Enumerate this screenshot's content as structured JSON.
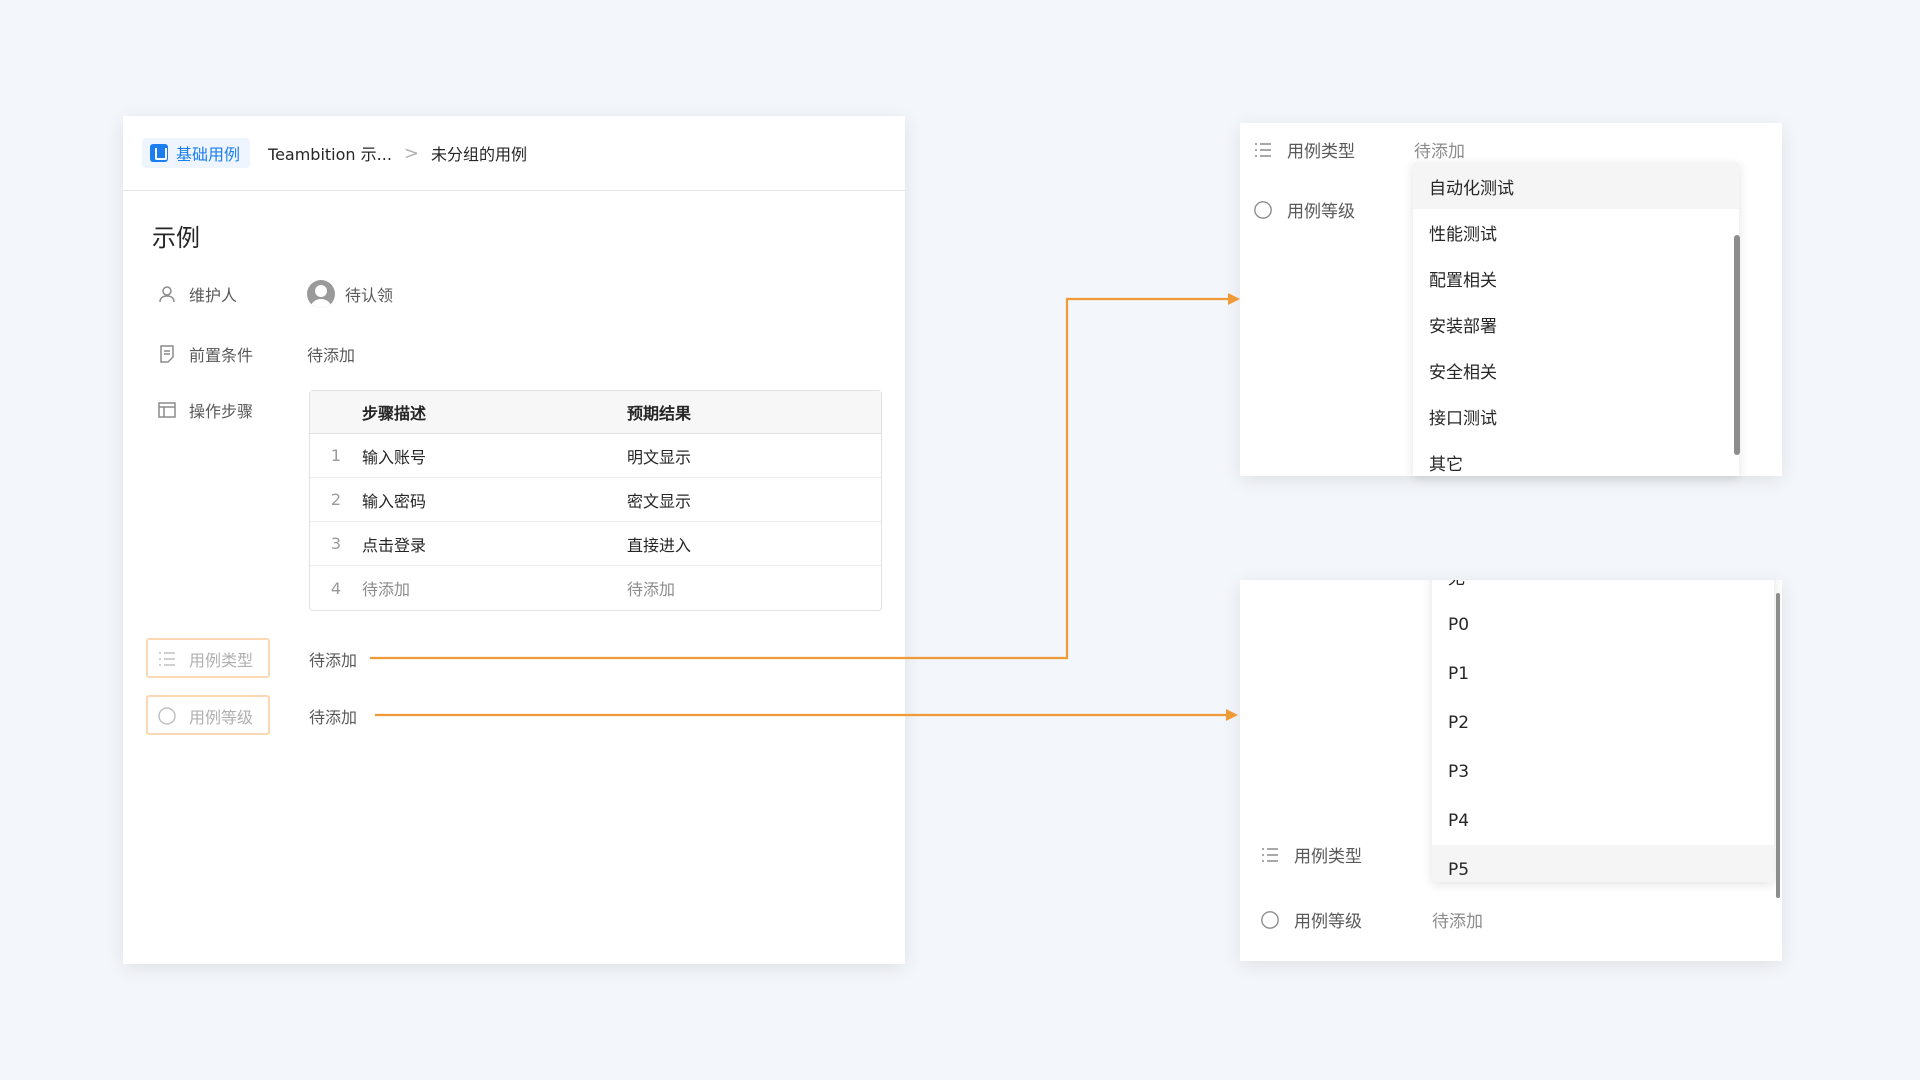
{
  "breadcrumb": {
    "tag_label": "基础用例",
    "project": "Teambition 示...",
    "separator": ">",
    "group": "未分组的用例"
  },
  "case": {
    "title": "示例",
    "maintainer_label": "维护人",
    "maintainer_value": "待认领",
    "precondition_label": "前置条件",
    "precondition_value": "待添加",
    "steps_label": "操作步骤",
    "steps_header": {
      "desc": "步骤描述",
      "expect": "预期结果"
    },
    "steps": [
      {
        "no": "1",
        "desc": "输入账号",
        "expect": "明文显示"
      },
      {
        "no": "2",
        "desc": "输入密码",
        "expect": "密文显示"
      },
      {
        "no": "3",
        "desc": "点击登录",
        "expect": "直接进入"
      },
      {
        "no": "4",
        "desc": "待添加",
        "expect": "待添加"
      }
    ],
    "type_label": "用例类型",
    "type_value": "待添加",
    "level_label": "用例等级",
    "level_value": "待添加"
  },
  "type_panel": {
    "type_label": "用例类型",
    "type_value": "待添加",
    "level_label": "用例等级",
    "options": [
      "自动化测试",
      "性能测试",
      "配置相关",
      "安装部署",
      "安全相关",
      "接口测试",
      "其它"
    ]
  },
  "level_panel": {
    "type_label": "用例类型",
    "level_label": "用例等级",
    "level_value": "待添加",
    "options": [
      "无",
      "P0",
      "P1",
      "P2",
      "P3",
      "P4",
      "P5"
    ]
  },
  "colors": {
    "arrow": "#f09a37",
    "accent": "#1b7ef0",
    "highlight_border": "#fbd8b3"
  }
}
